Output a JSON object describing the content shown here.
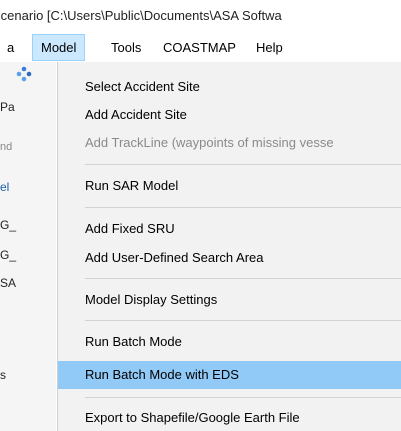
{
  "window": {
    "title": "Scenario [C:\\Users\\Public\\Documents\\ASA Softwa"
  },
  "menubar": {
    "items": [
      {
        "label": "a"
      },
      {
        "label": "Model"
      },
      {
        "label": "Tools"
      },
      {
        "label": "COASTMAP"
      },
      {
        "label": "Help"
      }
    ]
  },
  "left_panel": {
    "texts": [
      "Pa",
      "nd",
      "el",
      "G_",
      "G_",
      "SA",
      "s"
    ]
  },
  "model_menu": {
    "items": [
      {
        "label": "Select Accident Site",
        "enabled": true
      },
      {
        "label": "Add Accident Site",
        "enabled": true
      },
      {
        "label": "Add TrackLine (waypoints of missing vesse",
        "enabled": false
      },
      {
        "label": "Run SAR Model",
        "enabled": true
      },
      {
        "label": "Add Fixed SRU",
        "enabled": true
      },
      {
        "label": "Add User-Defined Search Area",
        "enabled": true
      },
      {
        "label": "Model Display Settings",
        "enabled": true
      },
      {
        "label": "Run Batch Mode",
        "enabled": true
      },
      {
        "label": "Run Batch Mode with EDS",
        "enabled": true,
        "highlighted": true
      },
      {
        "label": "Export to Shapefile/Google Earth File",
        "enabled": true
      }
    ]
  },
  "colors": {
    "menu_highlight": "#91c9f7",
    "menubar_active": "#cce8ff",
    "disabled_text": "#8a8a8a"
  }
}
